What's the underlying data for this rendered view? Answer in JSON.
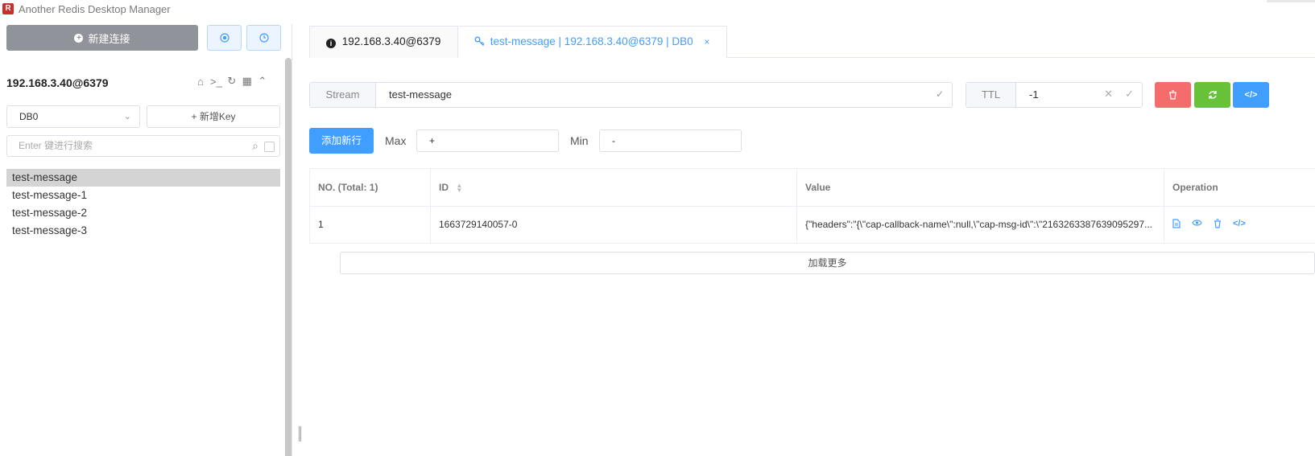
{
  "app": {
    "title": "Another Redis Desktop Manager",
    "icon": "redis-logo-icon"
  },
  "sidebar": {
    "new_connection_label": "新建连接",
    "connection_name": "192.168.3.40@6379",
    "db_select": {
      "value": "DB0"
    },
    "add_key_label": "+ 新增Key",
    "search": {
      "placeholder": "Enter 键进行搜索",
      "value": ""
    },
    "keys": [
      "test-message",
      "test-message-1",
      "test-message-2",
      "test-message-3"
    ],
    "selected_key_index": 0
  },
  "tabs": [
    {
      "label": "192.168.3.40@6379",
      "icon": "info-icon",
      "active": false
    },
    {
      "label": "test-message | 192.168.3.40@6379 | DB0",
      "icon": "key-icon",
      "active": true,
      "close": "×"
    }
  ],
  "key_detail": {
    "type_label": "Stream",
    "key_name": "test-message",
    "ttl_label": "TTL",
    "ttl_value": "-1",
    "colors": {
      "delete": "#f56c6c",
      "refresh": "#67c23a",
      "code": "#409eff"
    }
  },
  "stream": {
    "add_row_label": "添加新行",
    "max_label": "Max",
    "max_value": "+",
    "min_label": "Min",
    "min_value": "-"
  },
  "table": {
    "headers": {
      "no": "NO. (Total: 1)",
      "id": "ID",
      "value": "Value",
      "operation": "Operation"
    },
    "rows": [
      {
        "no": "1",
        "id": "1663729140057-0",
        "value": "{\"headers\":\"{\\\"cap-callback-name\\\":null,\\\"cap-msg-id\\\":\\\"2163263387639095297..."
      }
    ]
  },
  "load_more_label": "加载更多"
}
